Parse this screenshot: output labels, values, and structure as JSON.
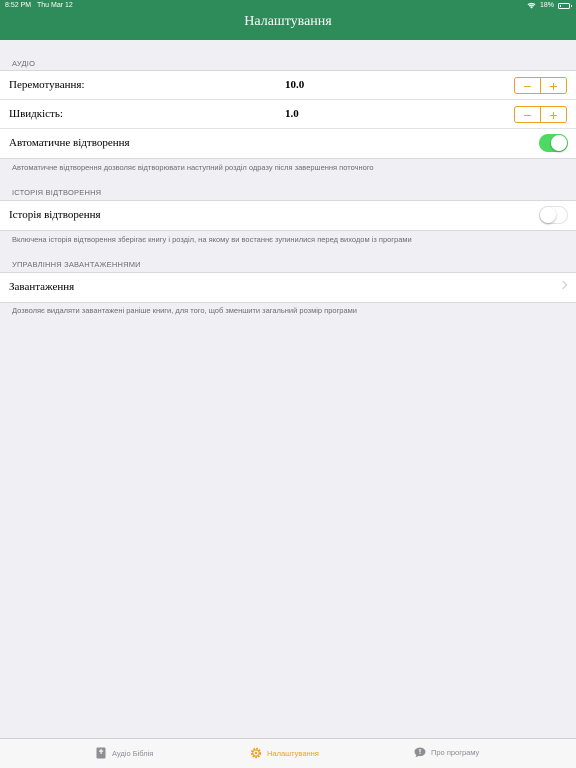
{
  "status_bar": {
    "time": "8:52 PM",
    "date": "Thu Mar 12",
    "battery": "18%",
    "battery_level": 0.18
  },
  "nav": {
    "title": "Налаштування"
  },
  "sections": {
    "audio": {
      "header": "АУДІО",
      "rewind": {
        "label": "Перемотування:",
        "value": "10.0",
        "minus": "−",
        "plus": "+"
      },
      "speed": {
        "label": "Швидкість:",
        "value": "1.0",
        "minus": "−",
        "plus": "+"
      },
      "autoplay": {
        "label": "Автоматичне відтворення",
        "enabled": true
      },
      "footer": "Автоматичне відтворення дозволяє відтворювати наступний розділ одразу після завершення поточного"
    },
    "history": {
      "header": "ІСТОРІЯ ВІДТВОРЕННЯ",
      "row": {
        "label": "Історія відтворення",
        "enabled": false
      },
      "footer": "Включена історія відтворення зберігає книгу і розділ, на якому ви востаннє зупинилися перед виходом із програми"
    },
    "downloads": {
      "header": "УПРАВЛІННЯ ЗАВАНТАЖЕННЯМИ",
      "row": {
        "label": "Завантаження"
      },
      "footer": "Дозволяє видаляти завантажені раніше книги, для того, щоб зменшити загальний розмір програми"
    }
  },
  "tabbar": {
    "tabs": [
      {
        "label": "Аудіо Біблія",
        "icon": "book-icon",
        "active": false
      },
      {
        "label": "Налаштування",
        "icon": "gear-icon",
        "active": true
      },
      {
        "label": "Про програму",
        "icon": "speech-bubble-icon",
        "active": false
      }
    ]
  },
  "colors": {
    "nav_bar": "#2e8c5a",
    "accent": "#f0a020",
    "switch_on": "#4cd964",
    "background": "#efeff4"
  }
}
